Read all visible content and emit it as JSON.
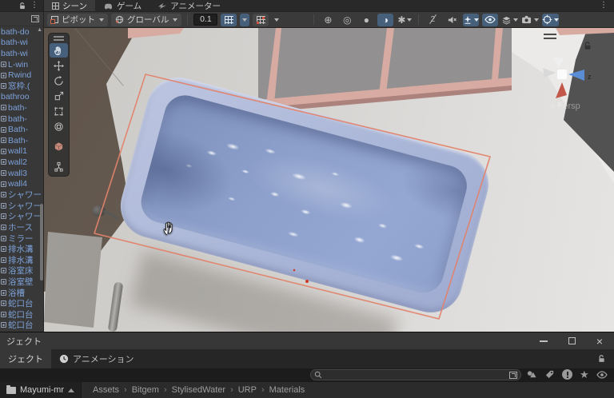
{
  "colors": {
    "accent_blue": "#46607c",
    "selection_outline": "#e2836b",
    "water": "#8da0cb",
    "tub_rim": "#aab6d8",
    "prefab_text": "#7ca1d9",
    "brown_floor": "#655a4e"
  },
  "top": {
    "tabs": [
      {
        "label": "シーン",
        "icon": "grid-icon",
        "active": true
      },
      {
        "label": "ゲーム",
        "icon": "gamepad-icon",
        "active": false
      },
      {
        "label": "アニメーター",
        "icon": "animator-icon",
        "active": false
      }
    ]
  },
  "toolbar": {
    "pivot_label": "ピボット",
    "global_label": "グローバル",
    "snap_value": "0.1",
    "hidden_count": "2"
  },
  "icons": {
    "kebab": "⋮",
    "close": "×",
    "star": "★",
    "scroll_up": "▲",
    "draw_mode": "⊕",
    "render_doodads": "◎",
    "lighting": "●",
    "crescent": "◑",
    "flare": "✱"
  },
  "hierarchy": {
    "items": [
      {
        "label": "bath-do",
        "has_icon": false
      },
      {
        "label": "bath-wi",
        "has_icon": false
      },
      {
        "label": "bath-wi",
        "has_icon": false
      },
      {
        "label": "L-win",
        "has_icon": true
      },
      {
        "label": "Rwind",
        "has_icon": true
      },
      {
        "label": "窓枠.(",
        "has_icon": true
      },
      {
        "label": "bathroo",
        "has_icon": false
      },
      {
        "label": "bath-",
        "has_icon": true
      },
      {
        "label": "bath-",
        "has_icon": true
      },
      {
        "label": "Bath-",
        "has_icon": true
      },
      {
        "label": "Bath-",
        "has_icon": true
      },
      {
        "label": "wall1",
        "has_icon": true
      },
      {
        "label": "wall2",
        "has_icon": true
      },
      {
        "label": "wall3",
        "has_icon": true
      },
      {
        "label": "wall4",
        "has_icon": true
      },
      {
        "label": "シャワー",
        "has_icon": true
      },
      {
        "label": "シャワー",
        "has_icon": true
      },
      {
        "label": "シャワー",
        "has_icon": true
      },
      {
        "label": "ホース",
        "has_icon": true
      },
      {
        "label": "ミラー",
        "has_icon": true
      },
      {
        "label": "排水溝",
        "has_icon": true
      },
      {
        "label": "排水溝",
        "has_icon": true
      },
      {
        "label": "浴室床",
        "has_icon": true
      },
      {
        "label": "浴室壁",
        "has_icon": true
      },
      {
        "label": "浴槽",
        "has_icon": true
      },
      {
        "label": "蛇口台",
        "has_icon": true
      },
      {
        "label": "蛇口台",
        "has_icon": true
      },
      {
        "label": "蛇口台",
        "has_icon": true
      }
    ]
  },
  "scene": {
    "gizmo": {
      "z": "z",
      "x": "x",
      "persp": "Persp"
    }
  },
  "bottom": {
    "window_title": "ジェクト",
    "tabs": [
      {
        "label": "ジェクト",
        "active": true
      },
      {
        "label": "アニメーション",
        "active": false
      }
    ],
    "search": {
      "value": "",
      "placeholder": ""
    },
    "breadcrumb": {
      "root": "Mayumi-mr",
      "items": [
        {
          "sep": "",
          "label": "Assets"
        },
        {
          "sep": "›",
          "label": "Bitgem"
        },
        {
          "sep": "›",
          "label": "StylisedWater"
        },
        {
          "sep": "›",
          "label": "URP"
        },
        {
          "sep": "›",
          "label": "Materials"
        }
      ]
    }
  }
}
